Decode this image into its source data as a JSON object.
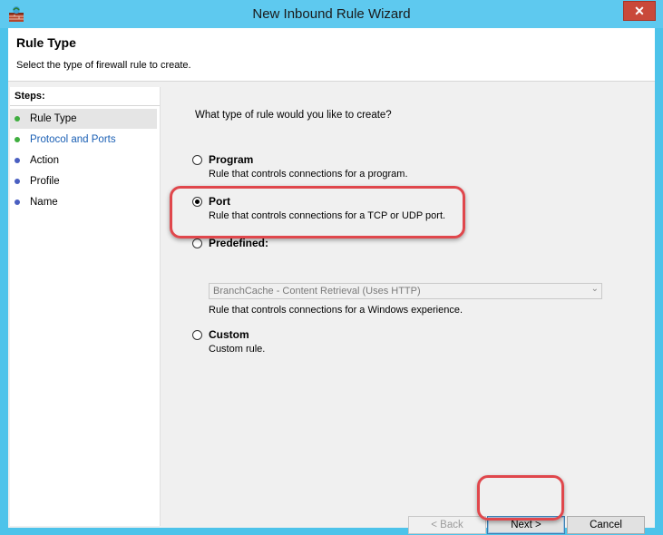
{
  "window": {
    "title": "New Inbound Rule Wizard",
    "close_label": "✕"
  },
  "header": {
    "title": "Rule Type",
    "subtitle": "Select the type of firewall rule to create."
  },
  "steps": {
    "title": "Steps:",
    "items": [
      {
        "label": "Rule Type",
        "status": "completed",
        "color": "#3fae3f"
      },
      {
        "label": "Protocol and Ports",
        "status": "current",
        "color": "#3fae3f"
      },
      {
        "label": "Action",
        "status": "pending",
        "color": "#4a5fc1"
      },
      {
        "label": "Profile",
        "status": "pending",
        "color": "#4a5fc1"
      },
      {
        "label": "Name",
        "status": "pending",
        "color": "#4a5fc1"
      }
    ]
  },
  "main": {
    "question": "What type of rule would you like to create?",
    "options": [
      {
        "label": "Program",
        "desc": "Rule that controls connections for a program.",
        "checked": false
      },
      {
        "label": "Port",
        "desc": "Rule that controls connections for a TCP or UDP port.",
        "checked": true
      },
      {
        "label": "Predefined:",
        "desc": "Rule that controls connections for a Windows experience.",
        "checked": false
      },
      {
        "label": "Custom",
        "desc": "Custom rule.",
        "checked": false
      }
    ],
    "predefined_select": {
      "value": "BranchCache - Content Retrieval (Uses HTTP)",
      "disabled": true
    }
  },
  "buttons": {
    "back": "< Back",
    "next": "Next >",
    "cancel": "Cancel"
  },
  "colors": {
    "title_bar": "#5ec9ef",
    "highlight": "#e0474c",
    "link": "#1a5fb4"
  }
}
